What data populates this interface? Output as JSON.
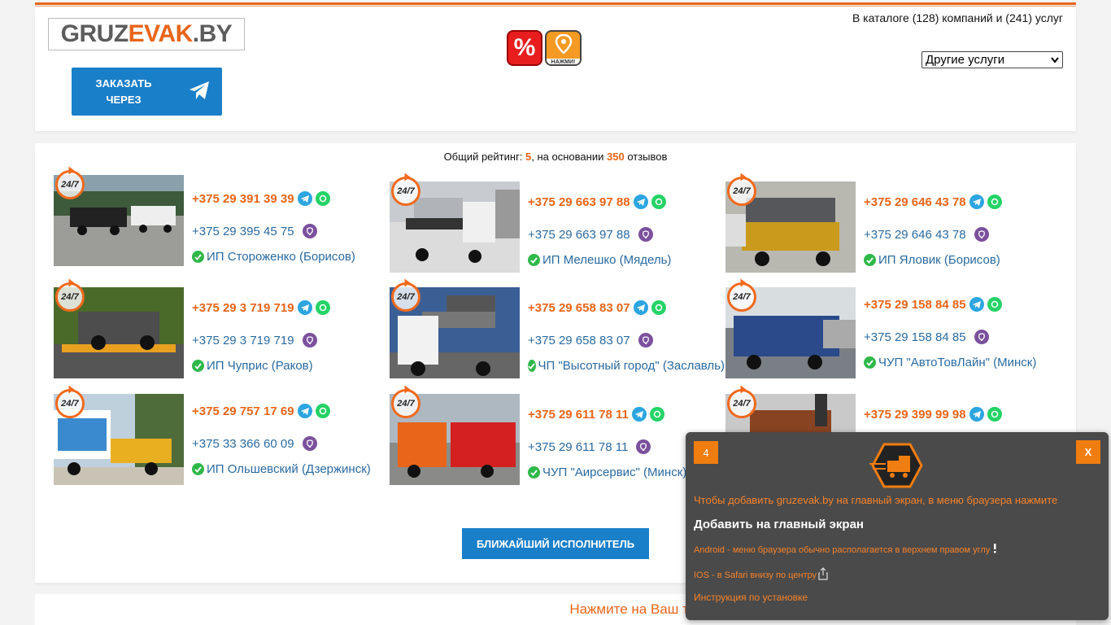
{
  "header": {
    "logo_part1": "GRUZ",
    "logo_part2": "EVAK",
    "logo_part3": ".BY",
    "order_button": "ЗАКАЗАТЬ ЧЕРЕЗ",
    "promo_label": "%",
    "map_button_caption": "НАЖМИ!",
    "catalog_text": "В каталоге (128) компаний и (241) услуг",
    "service_select_value": "Другие услуги"
  },
  "rating": {
    "prefix": "Общий рейтинг:",
    "score": "5",
    "middle": ", на основании",
    "reviews": "350",
    "suffix": "отзывов"
  },
  "badge_text": "24/7",
  "cards": [
    {
      "phone1": "+375 29 391 39 39",
      "phone2": "+375 29 395 45 75",
      "company": "ИП Стороженко (Борисов)"
    },
    {
      "phone1": "+375 29 663 97 88",
      "phone2": "+375 29 663 97 88",
      "company": "ИП Мелешко (Мядель)"
    },
    {
      "phone1": "+375 29 646 43 78",
      "phone2": "+375 29 646 43 78",
      "company": "ИП Яловик (Борисов)"
    },
    {
      "phone1": "+375 29 3 719 719",
      "phone2": "+375 29 3 719 719",
      "company": "ИП Чуприс (Раков)"
    },
    {
      "phone1": "+375 29 658 83 07",
      "phone2": "+375 29 658 83 07",
      "company": "ЧП \"Высотный город\" (Заславль)"
    },
    {
      "phone1": "+375 29 158 84 85",
      "phone2": "+375 29 158 84 85",
      "company": "ЧУП \"АвтоТовЛайн\" (Минск)"
    },
    {
      "phone1": "+375 29 757 17 69",
      "phone2": "+375 33 366 60 09",
      "company": "ИП Ольшевский (Дзержинск)"
    },
    {
      "phone1": "+375 29 611 78 11",
      "phone2": "+375 29 611 78 11",
      "company": "ЧУП \"Аирсервис\" (Минск)"
    },
    {
      "phone1": "+375 29 399 99 98",
      "phone2": "",
      "company": ""
    }
  ],
  "nearest_button": "БЛИЖАЙШИЙ ИСПОЛНИТЕЛЬ",
  "bottom_title": "Нажмите на Ваш тип транспорта",
  "popup": {
    "count": "4",
    "close": "X",
    "line1": "Чтобы добавить gruzevak.by на главный экран, в меню браузера нажмите",
    "line2": "Добавить на главный экран",
    "line3": "Android - меню браузера обычно располагается в верхнем правом углу",
    "line4": "IOS - в Safari внизу по центру",
    "line5": "Инструкция по установке"
  },
  "colors": {
    "accent_orange": "#e8651a",
    "button_blue": "#1a7fc9",
    "link_blue": "#2a6aa0",
    "popup_bg": "#4a4a4a"
  }
}
